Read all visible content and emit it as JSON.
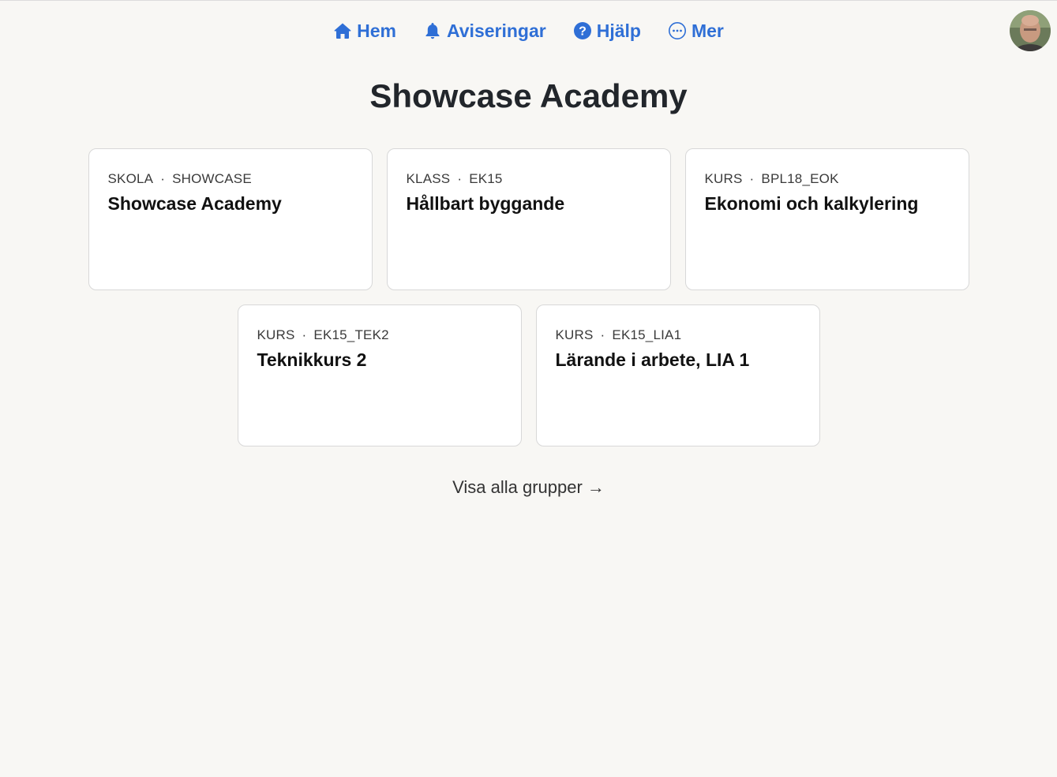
{
  "nav": {
    "items": [
      {
        "label": "Hem",
        "icon": "home-icon"
      },
      {
        "label": "Aviseringar",
        "icon": "bell-icon"
      },
      {
        "label": "Hjälp",
        "icon": "help-icon"
      },
      {
        "label": "Mer",
        "icon": "more-icon"
      }
    ],
    "accent_color": "#2f6fd6"
  },
  "page": {
    "title": "Showcase Academy"
  },
  "cards": [
    {
      "type": "SKOLA",
      "code": "SHOWCASE",
      "name": "Showcase Academy"
    },
    {
      "type": "KLASS",
      "code": "EK15",
      "name": "Hållbart byggande"
    },
    {
      "type": "KURS",
      "code": "BPL18_EOK",
      "name": "Ekonomi och kalkylering"
    },
    {
      "type": "KURS",
      "code": "EK15_TEK2",
      "name": "Teknikkurs 2"
    },
    {
      "type": "KURS",
      "code": "EK15_LIA1",
      "name": "Lärande i arbete, LIA 1"
    }
  ],
  "footer": {
    "show_all": "Visa alla grupper →"
  }
}
